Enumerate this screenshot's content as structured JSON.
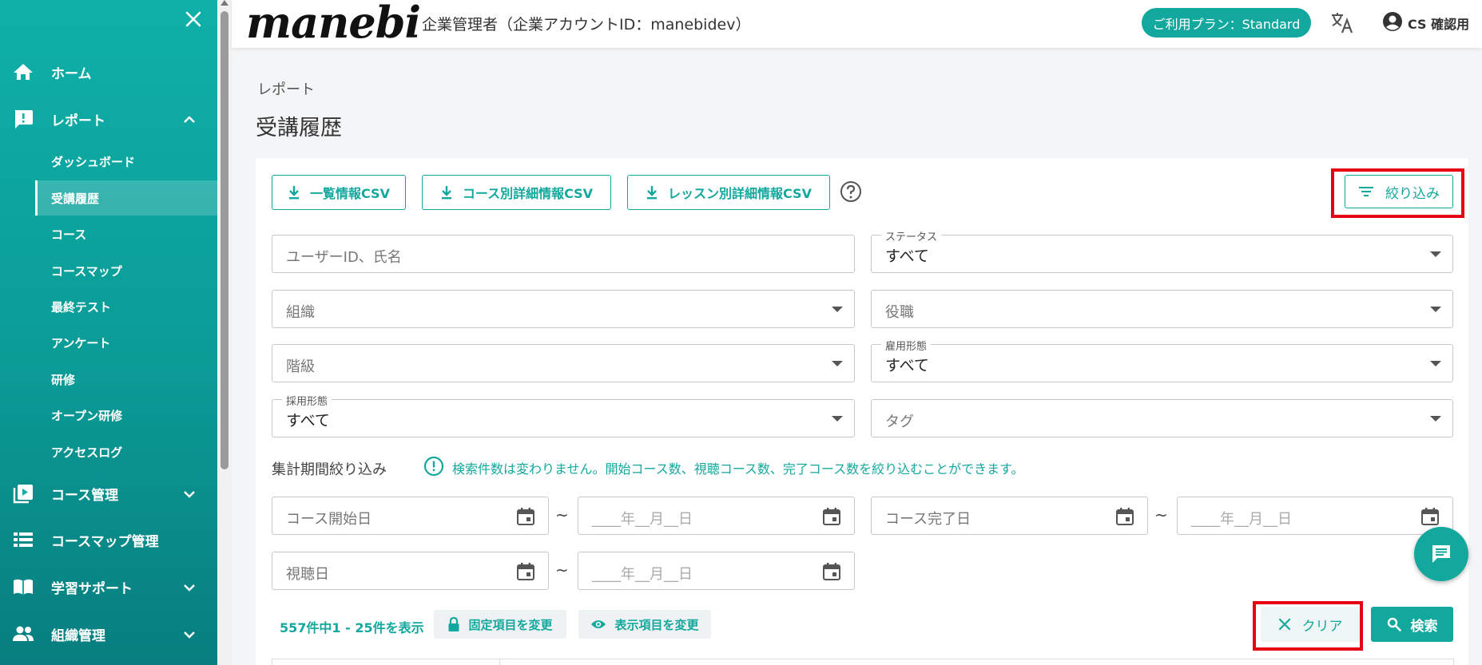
{
  "sidebar": {
    "items": [
      {
        "label": "ホーム"
      },
      {
        "label": "レポート"
      },
      {
        "label": "コース管理"
      },
      {
        "label": "コースマップ管理"
      },
      {
        "label": "学習サポート"
      },
      {
        "label": "組織管理"
      }
    ],
    "sub_items": [
      {
        "label": "ダッシュボード"
      },
      {
        "label": "受講履歴"
      },
      {
        "label": "コース"
      },
      {
        "label": "コースマップ"
      },
      {
        "label": "最終テスト"
      },
      {
        "label": "アンケート"
      },
      {
        "label": "研修"
      },
      {
        "label": "オープン研修"
      },
      {
        "label": "アクセスログ"
      }
    ]
  },
  "header": {
    "logo": "manebi",
    "admin_label": "企業管理者（企業アカウントID：manebidev）",
    "plan_badge": "ご利用プラン：Standard",
    "user_name": "CS 確認用"
  },
  "page": {
    "breadcrumb": "レポート",
    "title": "受講履歴"
  },
  "toolbar": {
    "csv_list": "一覧情報CSV",
    "csv_course": "コース別詳細情報CSV",
    "csv_lesson": "レッスン別詳細情報CSV",
    "filter": "絞り込み"
  },
  "filters": {
    "user_search_placeholder": "ユーザーID、氏名",
    "status_label": "ステータス",
    "status_value": "すべて",
    "organization_placeholder": "組織",
    "position_placeholder": "役職",
    "grade_placeholder": "階級",
    "employment_type_label": "雇用形態",
    "employment_type_value": "すべて",
    "hiring_type_label": "採用形態",
    "hiring_type_value": "すべて",
    "tag_placeholder": "タグ"
  },
  "period": {
    "label": "集計期間絞り込み",
    "info": "検索件数は変わりません。開始コース数、視聴コース数、完了コース数を絞り込むことができます。",
    "course_start_placeholder": "コース開始日",
    "course_complete_placeholder": "コース完了日",
    "view_date_placeholder": "視聴日",
    "date_placeholder": "____年__月__日",
    "tilde": "~"
  },
  "results": {
    "count_text": "557件中1 - 25件を表示",
    "fixed_columns": "固定項目を変更",
    "display_columns": "表示項目を変更",
    "clear": "クリア",
    "search": "検索"
  },
  "colors": {
    "accent": "#13a89e",
    "highlight": "#e60012"
  }
}
